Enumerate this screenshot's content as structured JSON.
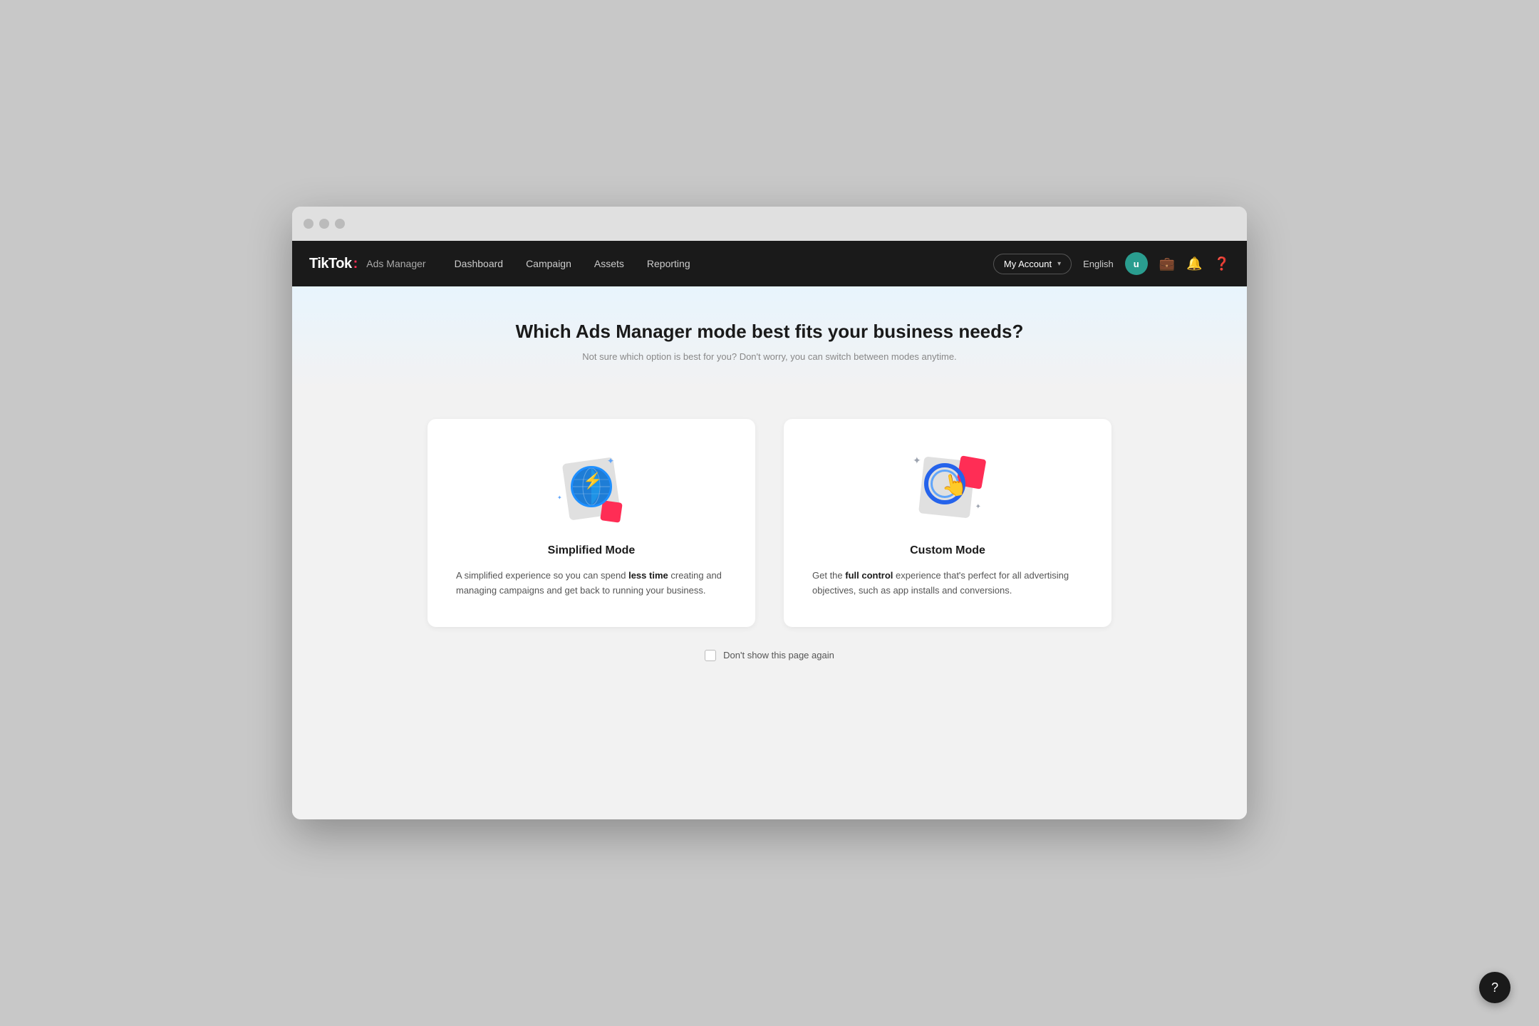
{
  "browser": {
    "buttons": [
      "close",
      "minimize",
      "maximize"
    ]
  },
  "navbar": {
    "brand": {
      "tiktok": "TikTok",
      "dot": ":",
      "product": "Ads Manager"
    },
    "links": [
      {
        "id": "dashboard",
        "label": "Dashboard"
      },
      {
        "id": "campaign",
        "label": "Campaign"
      },
      {
        "id": "assets",
        "label": "Assets"
      },
      {
        "id": "reporting",
        "label": "Reporting"
      }
    ],
    "account": {
      "label": "My Account",
      "chevron": "▾"
    },
    "language": "English",
    "user_initial": "u"
  },
  "hero": {
    "title": "Which Ads Manager mode best fits your business needs?",
    "subtitle": "Not sure which option is best for you? Don't worry, you can switch between modes anytime."
  },
  "cards": [
    {
      "id": "simplified",
      "title": "Simplified Mode",
      "description_parts": [
        "A simplified experience so you can spend ",
        "less time",
        " creating and managing campaigns and get back to running your business."
      ]
    },
    {
      "id": "custom",
      "title": "Custom Mode",
      "description_parts": [
        "Get the ",
        "full control",
        " experience that's perfect for all advertising objectives, such as app installs and conversions."
      ]
    }
  ],
  "checkbox": {
    "label": "Don't show this page again"
  },
  "floating_help": {
    "icon": "?"
  }
}
